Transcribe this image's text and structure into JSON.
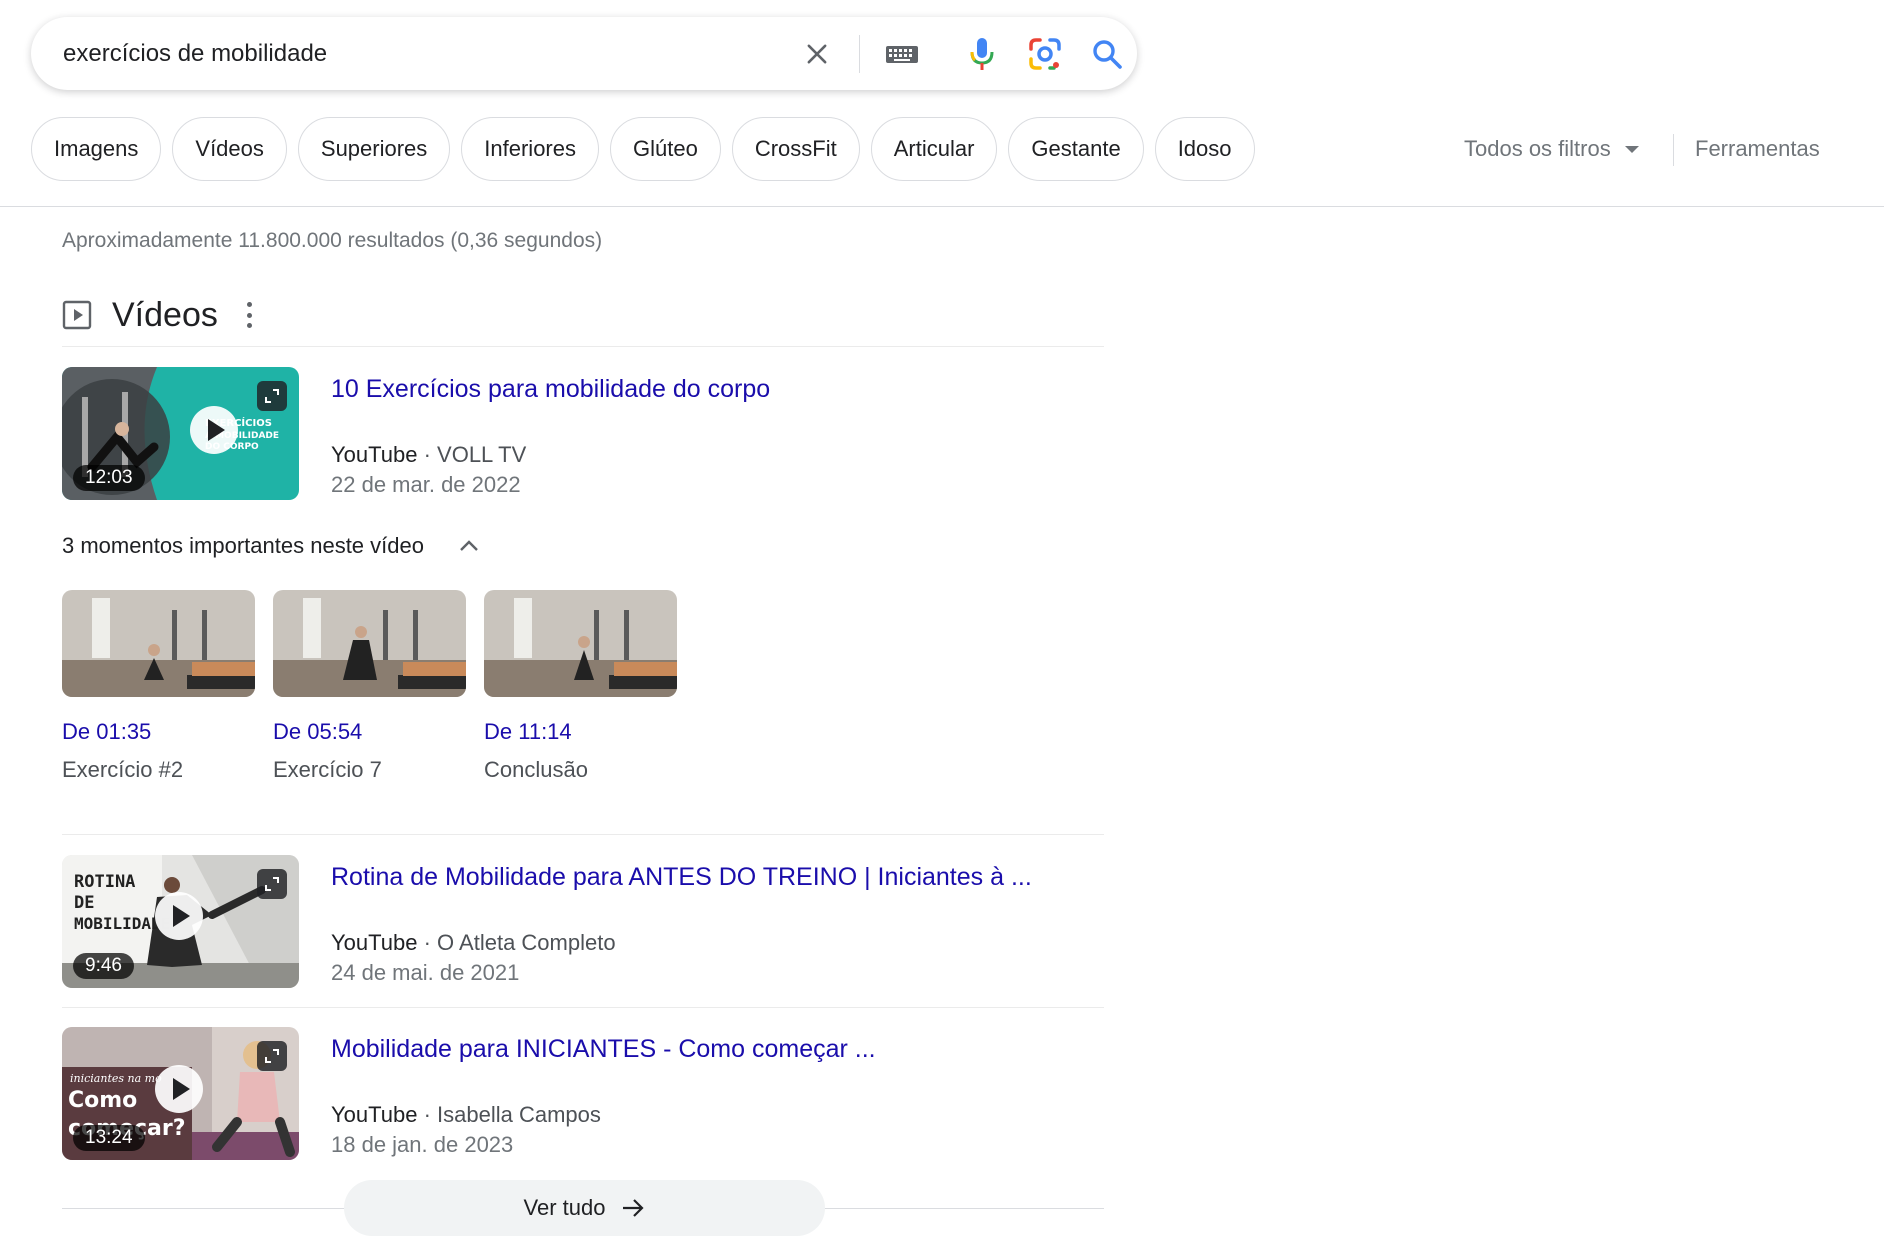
{
  "search": {
    "query": "exercícios de mobilidade"
  },
  "chips": [
    "Imagens",
    "Vídeos",
    "Superiores",
    "Inferiores",
    "Glúteo",
    "CrossFit",
    "Articular",
    "Gestante",
    "Idoso"
  ],
  "filters": {
    "all_filters": "Todos os filtros",
    "tools": "Ferramentas"
  },
  "stats": "Aproximadamente 11.800.000 resultados (0,36 segundos)",
  "videos_section": {
    "title": "Vídeos",
    "results": [
      {
        "title": "10 Exercícios para mobilidade do corpo",
        "site": "YouTube",
        "channel": "VOLL TV",
        "date": "22 de mar. de 2022",
        "duration": "12:03",
        "thumb_text": [
          "EXERCÍCIOS",
          "A MOBILIDADE",
          "DO CORPO"
        ]
      },
      {
        "title": "Rotina de Mobilidade para ANTES DO TREINO | Iniciantes à ...",
        "site": "YouTube",
        "channel": "O Atleta Completo",
        "date": "24 de mai. de 2021",
        "duration": "9:46",
        "thumb_text": [
          "ROTINA",
          "DE",
          "MOBILIDADE"
        ]
      },
      {
        "title": "Mobilidade para INICIANTES - Como começar ...",
        "site": "YouTube",
        "channel": "Isabella Campos",
        "date": "18 de jan. de 2023",
        "duration": "13:24",
        "thumb_text": [
          "iniciantes na mo",
          "Como",
          "começar?"
        ]
      }
    ],
    "key_moments": {
      "header": "3 momentos importantes neste vídeo",
      "items": [
        {
          "time": "De 01:35",
          "label": "Exercício #2"
        },
        {
          "time": "De 05:54",
          "label": "Exercício 7"
        },
        {
          "time": "De 11:14",
          "label": "Conclusão"
        }
      ]
    },
    "see_all": "Ver tudo"
  },
  "colors": {
    "link": "#1a0dab",
    "muted": "#70757a",
    "accent_blue": "#4285f4",
    "thumb_teal": "#1fb3a6"
  },
  "separator": "·"
}
